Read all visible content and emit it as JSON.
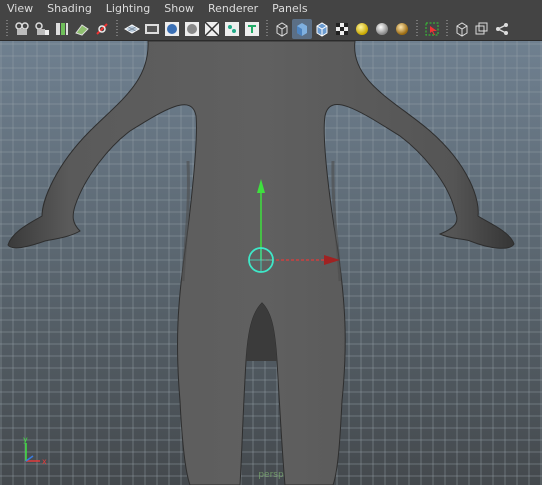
{
  "menu": {
    "items": [
      "View",
      "Shading",
      "Lighting",
      "Show",
      "Renderer",
      "Panels"
    ]
  },
  "toolbar": {
    "groups": [
      [
        "camera-select-icon",
        "camera-attributes-icon",
        "bookmarks-icon",
        "image-plane-icon",
        "two-d-pan-zoom-icon"
      ],
      [
        "grid-icon",
        "film-gate-icon",
        "resolution-gate-icon",
        "gate-mask-icon",
        "field-chart-icon",
        "safe-action-icon",
        "safe-title-icon"
      ],
      [
        "wireframe-icon",
        "smooth-shade-icon",
        "wireframe-on-shaded-icon",
        "textured-icon",
        "default-light-icon",
        "shadows-icon",
        "ambient-occlusion-icon"
      ],
      [
        "isolate-select-icon"
      ],
      [
        "xray-icon",
        "xray-active-components-icon",
        "xray-joints-icon"
      ]
    ],
    "active": [
      "smooth-shade-icon"
    ]
  },
  "viewport": {
    "camera_label": "persp",
    "axis": {
      "x": "x",
      "y": "y",
      "z": "z"
    },
    "colors": {
      "x_axis": "#e23a3a",
      "y_axis": "#3ee03e",
      "z_axis": "#3a7ae2"
    }
  }
}
